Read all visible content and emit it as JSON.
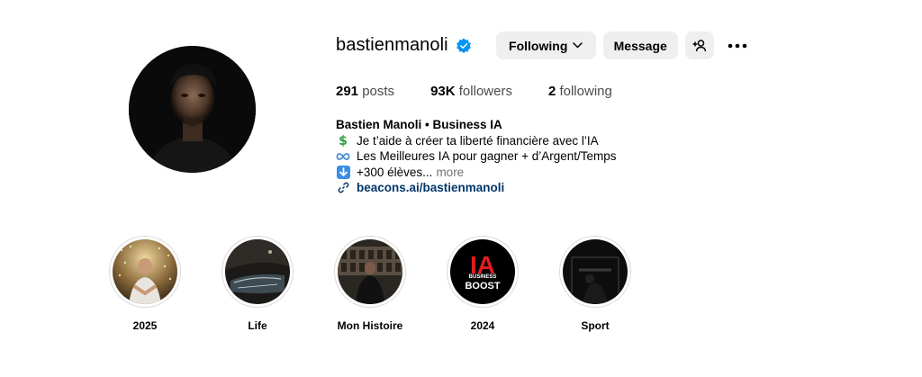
{
  "profile": {
    "username": "bastienmanoli",
    "verified": true,
    "following_label": "Following",
    "message_label": "Message"
  },
  "stats": {
    "posts_count": "291",
    "posts_label": "posts",
    "followers_count": "93K",
    "followers_label": "followers",
    "following_count": "2",
    "following_label": "following"
  },
  "bio": {
    "full_name": "Bastien Manoli • Business IA",
    "line1": "Je t’aide à créer ta liberté financière avec l’IA",
    "line2": "Les Meilleures IA pour gagner + d’Argent/Temps",
    "line3": "+300 élèves...",
    "more_label": "more",
    "link": "beacons.ai/bastienmanoli"
  },
  "highlights": [
    {
      "label": "2025"
    },
    {
      "label": "Life"
    },
    {
      "label": "Mon Histoire"
    },
    {
      "label": "2024",
      "cover_text_top": "IA",
      "cover_text_mid": "BUSINESS",
      "cover_text_bottom": "BOOST"
    },
    {
      "label": "Sport"
    }
  ],
  "colors": {
    "button_bg": "#efefef",
    "verified_blue": "#0095f6",
    "link": "#00376b",
    "muted": "#737373",
    "ia_red": "#e11b22"
  }
}
